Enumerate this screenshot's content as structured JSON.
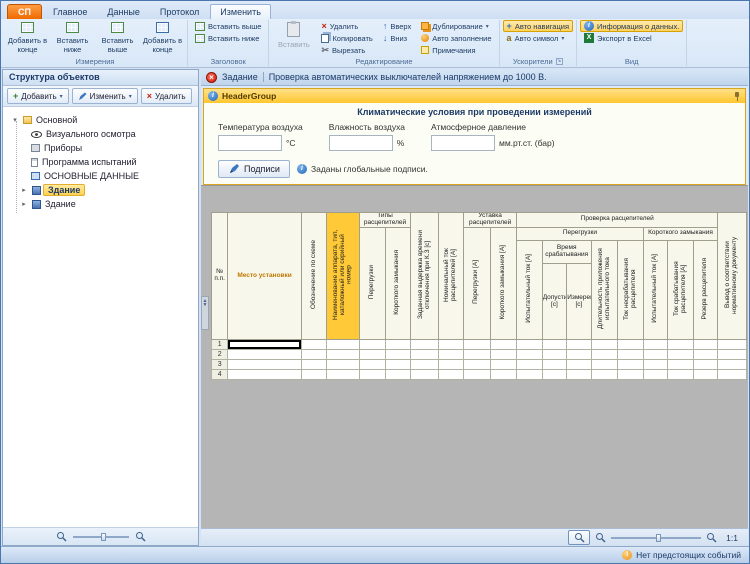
{
  "ribbon": {
    "app_tab": "СП",
    "tabs": [
      "Главное",
      "Данные",
      "Протокол",
      "Изменить"
    ],
    "groups": {
      "measure": {
        "label": "Измерения",
        "b0": "Добавить в конце",
        "b1": "Вставить ниже",
        "b2": "Вставить выше",
        "b3": "Добавить в конце"
      },
      "header": {
        "label": "Заголовок",
        "b0": "Вставить выше",
        "b1": "Вставить ниже"
      },
      "edit": {
        "label": "Редактирование",
        "big": "Вставить",
        "b0": "Удалить",
        "b1": "Копировать",
        "b2": "Вырезать",
        "b3": "Вверх",
        "b4": "Вниз",
        "b5": "Дублирование",
        "b6": "Авто заполнение",
        "b7": "Примечания"
      },
      "accel": {
        "label": "Ускорители",
        "b0": "Авто навигация",
        "b1": "Авто символ"
      },
      "view": {
        "label": "Вид",
        "b0": "Информация о данных.",
        "b1": "Экспорт в Excel"
      }
    }
  },
  "sidebar": {
    "title": "Структура объектов",
    "add": "Добавить",
    "edit": "Изменить",
    "delete": "Удалить",
    "tree": {
      "root": "Основной",
      "i0": "Визуального осмотра",
      "i1": "Приборы",
      "i2": "Программа испытаний",
      "i3": "ОСНОВНЫЕ ДАННЫЕ",
      "b0": "Здание",
      "b1": "Здание"
    }
  },
  "document": {
    "tab": "Задание",
    "title": "Проверка автоматических выключателей напряжением до 1000 В."
  },
  "header_group": {
    "title": "HeaderGroup",
    "section_title": "Климатические условия при проведении измерений",
    "f0": {
      "label": "Температура воздуха",
      "unit": "°С",
      "value": ""
    },
    "f1": {
      "label": "Влажность воздуха",
      "unit": "%",
      "value": ""
    },
    "f2": {
      "label": "Атмосферное давление",
      "unit": "мм.рт.ст. (бар)",
      "value": ""
    },
    "signatures_button": "Подписи",
    "signatures_note": "Заданы глобальные подписи."
  },
  "worksheet": {
    "columns": {
      "num": "№ п.п.",
      "place": "Место установки",
      "designation": "Обозначение по схеме",
      "name": "Наименование аппарата, тип, каталожный или серийный номер",
      "types_group": "Типы расцепителей",
      "types_overload": "Перегрузки",
      "types_short": "Короткого замыкания",
      "delay": "Заданная выдержка времени отключения при К.З [с]",
      "nominal": "Номинальный ток расцепителей [А]",
      "setting_group": "Уставка расцепителей",
      "setting_overload": "Перегрузки [А]",
      "setting_short": "Короткого замыкания [А]",
      "check_group": "Проверка расцепителей",
      "check_overload_group": "Перегрузки",
      "check_short_group": "Короткого замыкания",
      "test_current": "Испытательный ток [А]",
      "trip_time_group": "Время срабатывания",
      "trip_time_allowed": "Допустимое [с]",
      "trip_time_measured": "Измеренное [с]",
      "duration": "Длительность приложения испытательного тока",
      "no_trip_current": "Ток несрабатывания расцепителя",
      "sc_test_current": "Испытательный ток [А]",
      "sc_trip_current": "Ток срабатывания расцепителя [А]",
      "sc_reserve": "Резерв расцепителя",
      "conclusion": "Вывод о соответствии нормативному документу"
    },
    "rows": [
      "1",
      "2",
      "3",
      "4"
    ]
  },
  "zoom": {
    "scale": "1:1"
  },
  "status": {
    "message": "Нет предстоящих событий"
  },
  "colors": {
    "accent_orange": "#ef6a00",
    "selection_yellow": "#ffd24e",
    "header_yellow": "#ffc937"
  }
}
